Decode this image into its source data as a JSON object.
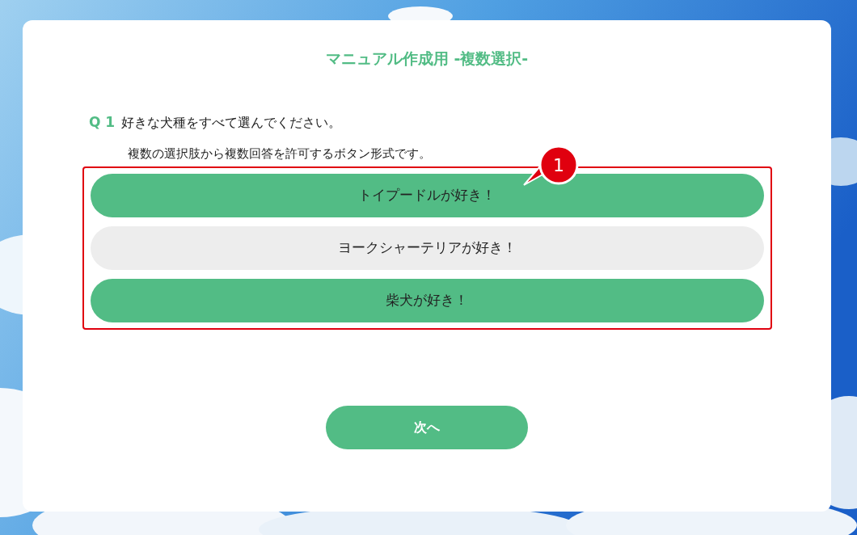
{
  "title": "マニュアル作成用 -複数選択-",
  "question": {
    "number": "Q 1",
    "text": "好きな犬種をすべて選んでください。",
    "note": "複数の選択肢から複数回答を許可するボタン形式です。"
  },
  "options": [
    {
      "label": "トイプードルが好き！",
      "selected": true
    },
    {
      "label": "ヨークシャーテリアが好き！",
      "selected": false
    },
    {
      "label": "柴犬が好き！",
      "selected": true
    }
  ],
  "callout": {
    "number": "1"
  },
  "next_button": "次へ"
}
